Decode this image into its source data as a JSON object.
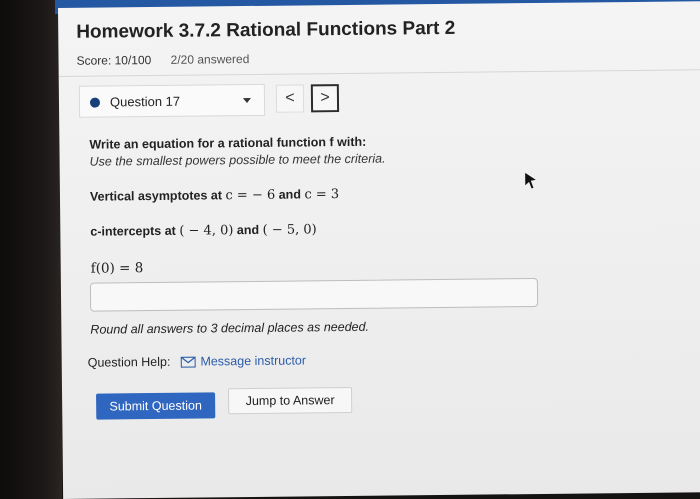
{
  "homework": {
    "title": "Homework 3.7.2 Rational Functions Part 2",
    "score": "Score: 10/100",
    "answered": "2/20 answered"
  },
  "question_nav": {
    "selected": "Question 17",
    "prev": "<",
    "next": ">"
  },
  "question": {
    "prompt": "Write an equation for a rational function f with:",
    "hint": "Use the smallest powers possible to meet the criteria.",
    "asymptote_label": "Vertical asymptotes at",
    "asymptote_math_1": "c = − 6",
    "asymptote_and": "and",
    "asymptote_math_2": "c = 3",
    "intercept_label": "c-intercepts at",
    "intercept_math_1": "( − 4, 0)",
    "intercept_and": "and",
    "intercept_math_2": "( − 5, 0)",
    "fvalue": "f(0) = 8"
  },
  "answer": {
    "value": ""
  },
  "round_note": "Round all answers to 3 decimal places as needed.",
  "help": {
    "label": "Question Help:",
    "link": "Message instructor",
    "icon": "mail-icon"
  },
  "buttons": {
    "submit": "Submit Question",
    "jump": "Jump to Answer"
  },
  "colors": {
    "accent": "#2f66bf",
    "link": "#2b5ca8",
    "question_dot": "#173f7a"
  }
}
